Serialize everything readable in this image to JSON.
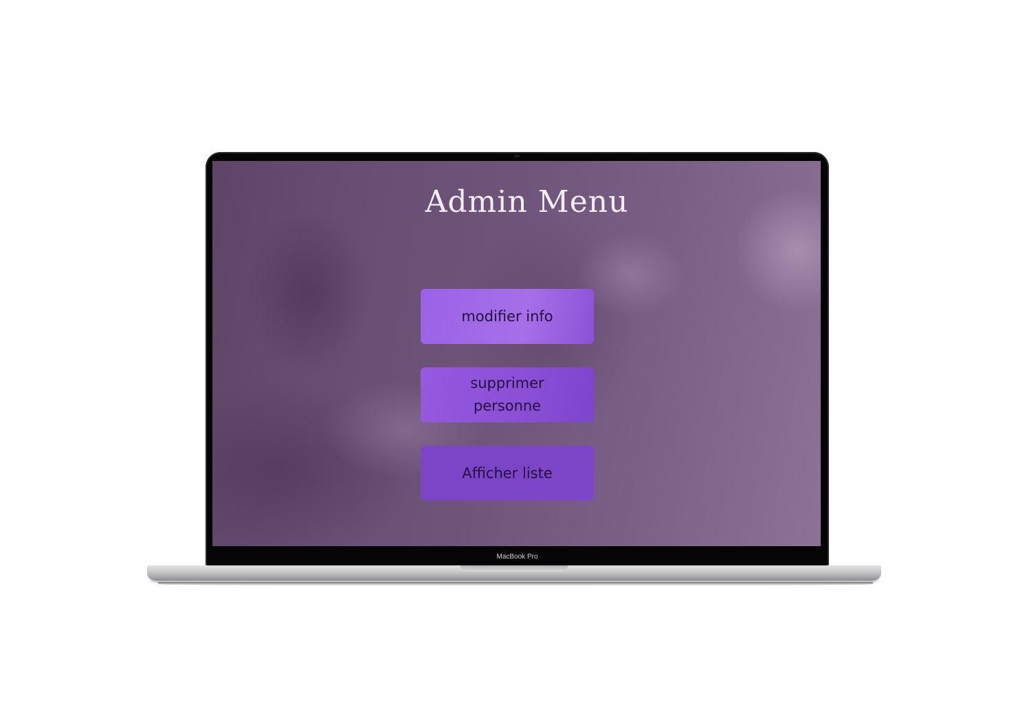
{
  "device": {
    "model_label": "MacBook Pro"
  },
  "app": {
    "title": "Admin Menu",
    "buttons": [
      {
        "label": "modifier info"
      },
      {
        "label": "supprimer personne"
      },
      {
        "label": "Afficher liste"
      }
    ]
  },
  "colors": {
    "screen_background": "#6e5478",
    "button_primary": "#9a62e6",
    "button_text": "#24103a",
    "title_text": "#f3eef4"
  }
}
